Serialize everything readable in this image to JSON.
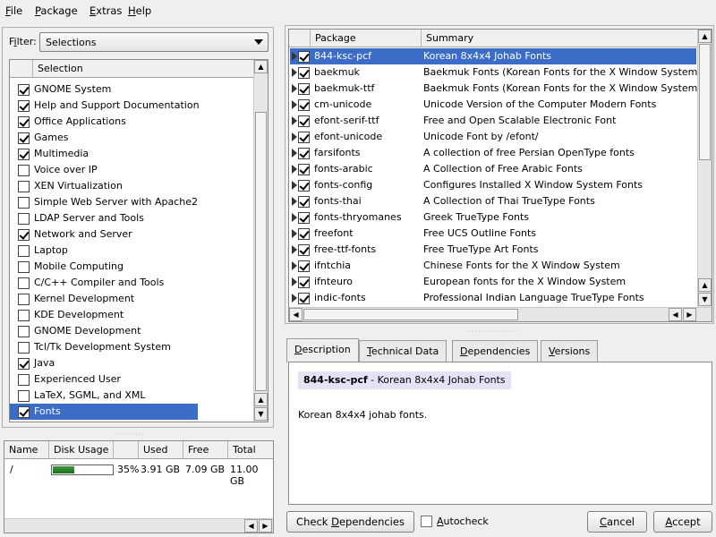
{
  "menubar": {
    "file": {
      "u": "F",
      "rest": "ile"
    },
    "package": {
      "u": "P",
      "rest": "ackage"
    },
    "extras": {
      "u": "E",
      "rest": "xtras"
    },
    "help": {
      "u": "H",
      "rest": "elp"
    }
  },
  "filter": {
    "label_u": "i",
    "label_pre": "F",
    "label_post": "lter:",
    "value": "Selections"
  },
  "selections": {
    "header": "Selection",
    "items": [
      {
        "label": "GNOME System",
        "checked": true
      },
      {
        "label": "Help and Support Documentation",
        "checked": true
      },
      {
        "label": "Office Applications",
        "checked": true
      },
      {
        "label": "Games",
        "checked": true
      },
      {
        "label": "Multimedia",
        "checked": true
      },
      {
        "label": "Voice over IP",
        "checked": false
      },
      {
        "label": "XEN Virtualization",
        "checked": false
      },
      {
        "label": "Simple Web Server with Apache2",
        "checked": false
      },
      {
        "label": "LDAP Server and Tools",
        "checked": false
      },
      {
        "label": "Network and Server",
        "checked": true
      },
      {
        "label": "Laptop",
        "checked": false
      },
      {
        "label": "Mobile Computing",
        "checked": false
      },
      {
        "label": "C/C++ Compiler and Tools",
        "checked": false
      },
      {
        "label": "Kernel Development",
        "checked": false
      },
      {
        "label": "KDE Development",
        "checked": false
      },
      {
        "label": "GNOME Development",
        "checked": false
      },
      {
        "label": "Tcl/Tk Development System",
        "checked": false
      },
      {
        "label": "Java",
        "checked": true
      },
      {
        "label": "Experienced User",
        "checked": false
      },
      {
        "label": "LaTeX, SGML, and XML",
        "checked": false
      },
      {
        "label": "Fonts",
        "checked": true,
        "selected": true
      }
    ]
  },
  "disk": {
    "headers": {
      "name": "Name",
      "usage": "Disk Usage",
      "used": "Used",
      "free": "Free",
      "total": "Total"
    },
    "rows": [
      {
        "name": "/",
        "percent_label": "35%",
        "fill": 0.35,
        "used": "3.91 GB",
        "free": "7.09 GB",
        "total": "11.00 GB"
      }
    ]
  },
  "packages": {
    "headers": {
      "package": "Package",
      "summary": "Summary"
    },
    "rows": [
      {
        "name": "844-ksc-pcf",
        "summary": "Korean 8x4x4 Johab Fonts",
        "checked": true,
        "selected": true
      },
      {
        "name": "baekmuk",
        "summary": "Baekmuk Fonts (Korean Fonts for the X Window System, Bi",
        "checked": true
      },
      {
        "name": "baekmuk-ttf",
        "summary": "Baekmuk Fonts (Korean Fonts for the X Window System, Tr",
        "checked": true
      },
      {
        "name": "cm-unicode",
        "summary": "Unicode Version of the Computer Modern Fonts",
        "checked": true
      },
      {
        "name": "efont-serif-ttf",
        "summary": "Free and Open Scalable Electronic Font",
        "checked": true
      },
      {
        "name": "efont-unicode",
        "summary": "Unicode Font by /efont/",
        "checked": true
      },
      {
        "name": "farsifonts",
        "summary": "A collection of free Persian OpenType fonts",
        "checked": true
      },
      {
        "name": "fonts-arabic",
        "summary": "A Collection of Free Arabic Fonts",
        "checked": true
      },
      {
        "name": "fonts-config",
        "summary": "Configures Installed X Window System Fonts",
        "checked": true
      },
      {
        "name": "fonts-thai",
        "summary": "A Collection of Thai TrueType Fonts",
        "checked": true
      },
      {
        "name": "fonts-thryomanes",
        "summary": "Greek TrueType Fonts",
        "checked": true
      },
      {
        "name": "freefont",
        "summary": "Free UCS Outline Fonts",
        "checked": true
      },
      {
        "name": "free-ttf-fonts",
        "summary": "Free TrueType Art Fonts",
        "checked": true
      },
      {
        "name": "ifntchia",
        "summary": "Chinese Fonts for the X Window System",
        "checked": true
      },
      {
        "name": "ifnteuro",
        "summary": "European fonts for the X Window System",
        "checked": true
      },
      {
        "name": "indic-fonts",
        "summary": "Professional Indian Language TrueType Fonts",
        "checked": true
      }
    ]
  },
  "tabs": [
    {
      "pre": "",
      "u": "D",
      "post": "escription",
      "active": true
    },
    {
      "pre": "",
      "u": "T",
      "post": "echnical Data"
    },
    {
      "pre": "",
      "u": "D",
      "post": "ependencies"
    },
    {
      "pre": "",
      "u": "V",
      "post": "ersions"
    }
  ],
  "description": {
    "name": "844-ksc-pcf",
    "summary": " - Korean 8x4x4 Johab Fonts",
    "body": "Korean 8x4x4 johab fonts."
  },
  "buttons": {
    "check_pre": "Check ",
    "check_u": "D",
    "check_post": "ependencies",
    "autocheck_u": "A",
    "autocheck_post": "utocheck",
    "cancel_u": "C",
    "cancel_post": "ancel",
    "accept_u": "A",
    "accept_post": "ccept"
  }
}
